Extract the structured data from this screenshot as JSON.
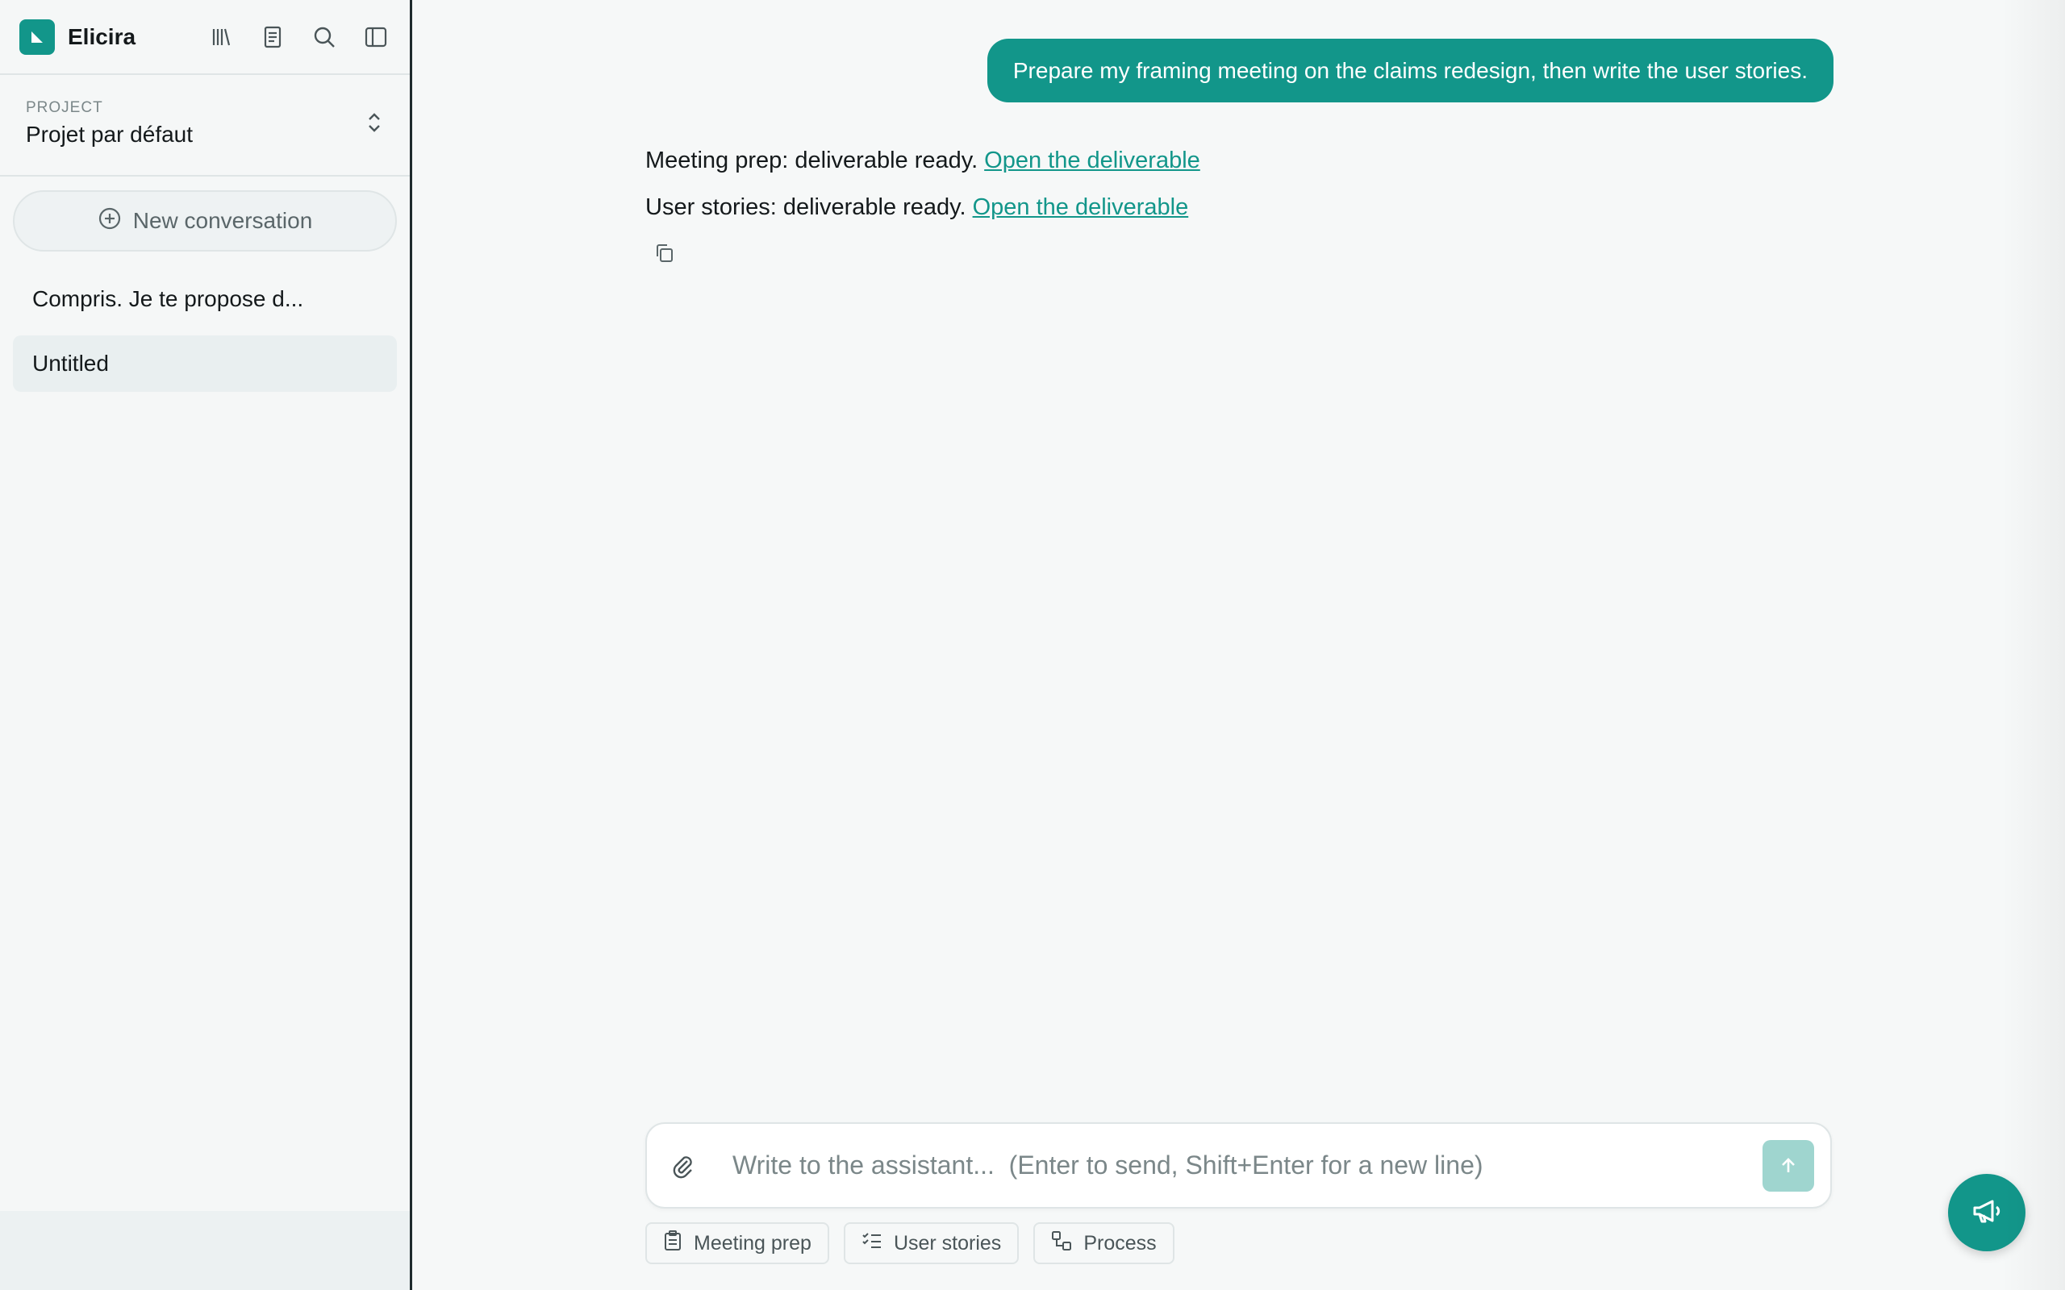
{
  "app": {
    "name": "Elicira"
  },
  "sidebar": {
    "project_label": "PROJECT",
    "project_name": "Projet par défaut",
    "new_conversation": "New conversation",
    "conversations": [
      {
        "label": "Compris. Je te propose d..."
      },
      {
        "label": "Untitled",
        "active": true
      }
    ]
  },
  "chat": {
    "user_message": "Prepare my framing meeting on the claims redesign, then write the user stories.",
    "reply_lines": [
      {
        "text": "Meeting prep: deliverable ready.",
        "link": "Open the deliverable"
      },
      {
        "text": "User stories: deliverable ready.",
        "link": "Open the deliverable"
      }
    ]
  },
  "composer": {
    "placeholder": "Write to the assistant...  (Enter to send, Shift+Enter for a new line)",
    "value": ""
  },
  "chips": [
    {
      "label": "Meeting prep",
      "icon": "clipboard-icon"
    },
    {
      "label": "User stories",
      "icon": "checklist-icon"
    },
    {
      "label": "Process",
      "icon": "process-icon"
    }
  ],
  "colors": {
    "accent": "#12968a",
    "send_disabled": "#9fd5cf"
  }
}
